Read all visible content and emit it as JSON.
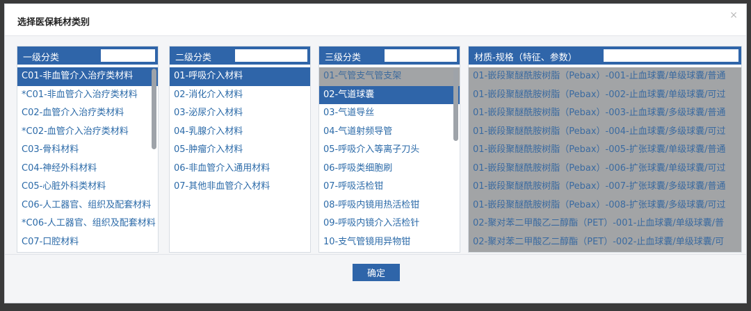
{
  "dialog": {
    "title": "选择医保耗材类别",
    "close": "×"
  },
  "panels": [
    {
      "header": "一级分类",
      "items": [
        "C01-非血管介入治疗类材料",
        "*C01-非血管介入治疗类材料",
        "C02-血管介入治疗类材料",
        "*C02-血管介入治疗类材料",
        "C03-骨科材料",
        "C04-神经外科材料",
        "C05-心脏外科类材料",
        "C06-人工器官、组织及配套材料",
        "*C06-人工器官、组织及配套材料",
        "C07-口腔材料"
      ]
    },
    {
      "header": "二级分类",
      "items": [
        "01-呼吸介入材料",
        "02-消化介入材料",
        "03-泌尿介入材料",
        "04-乳腺介入材料",
        "05-肿瘤介入材料",
        "06-非血管介入通用材料",
        "07-其他非血管介入材料"
      ]
    },
    {
      "header": "三级分类",
      "items": [
        "01-气管支气管支架",
        "02-气道球囊",
        "03-气道导丝",
        "04-气道射频导管",
        "05-呼吸介入等离子刀头",
        "06-呼吸类细胞刷",
        "07-呼吸活检钳",
        "08-呼吸内镜用热活检钳",
        "09-呼吸内镜介入活检针",
        "10-支气管镜用异物钳"
      ]
    },
    {
      "header": "材质-规格（特征、参数）",
      "items": [
        "01-嵌段聚醚酰胺树脂（Pebax）-001-止血球囊/单级球囊/普通",
        "01-嵌段聚醚酰胺树脂（Pebax）-002-止血球囊/单级球囊/可过",
        "01-嵌段聚醚酰胺树脂（Pebax）-003-止血球囊/多级球囊/普通",
        "01-嵌段聚醚酰胺树脂（Pebax）-004-止血球囊/多级球囊/可过",
        "01-嵌段聚醚酰胺树脂（Pebax）-005-扩张球囊/单级球囊/普通",
        "01-嵌段聚醚酰胺树脂（Pebax）-006-扩张球囊/单级球囊/可过",
        "01-嵌段聚醚酰胺树脂（Pebax）-007-扩张球囊/多级球囊/普通",
        "01-嵌段聚醚酰胺树脂（Pebax）-008-扩张球囊/多级球囊/可过",
        "02-聚对苯二甲酸乙二醇酯（PET）-001-止血球囊/单级球囊/普",
        "02-聚对苯二甲酸乙二醇酯（PET）-002-止血球囊/单级球囊/可"
      ]
    }
  ],
  "footer": {
    "ok_label": "确定"
  }
}
